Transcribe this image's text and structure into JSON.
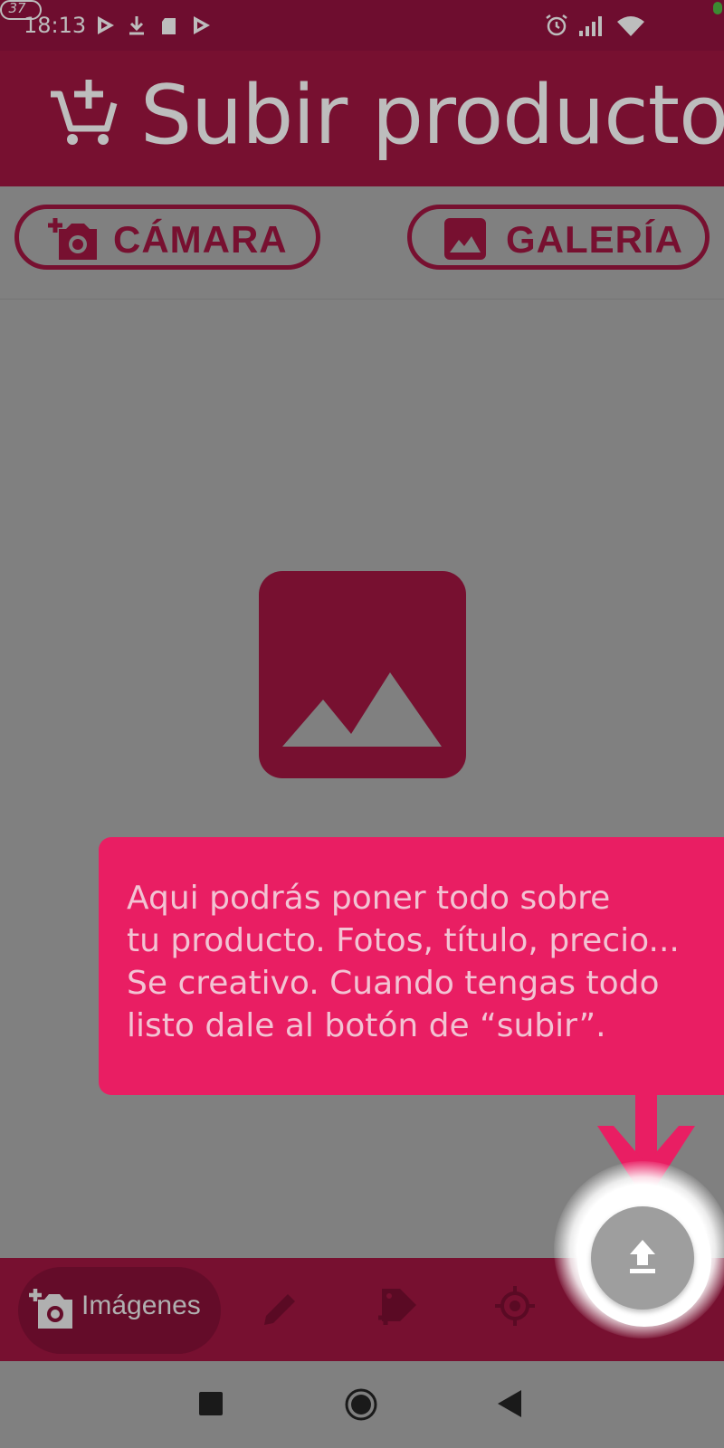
{
  "status_bar": {
    "time": "18:13",
    "battery_level": "37",
    "icons": [
      "play-store-icon",
      "download-icon",
      "sd-card-icon",
      "play-store-icon",
      "alarm-icon",
      "signal-icon",
      "wifi-icon",
      "battery-icon"
    ]
  },
  "app_bar": {
    "title": "Subir producto",
    "icon": "add-shopping-cart-icon"
  },
  "toolbar": {
    "camera_label": "CÁMARA",
    "gallery_label": "GALERÍA"
  },
  "placeholder": {
    "icon": "image-icon"
  },
  "tooltip": {
    "text": "Aqui podrás poner todo sobre\ntu producto. Fotos, título, precio...\nSe creativo. Cuando tengas todo\nlisto dale al botón de “subir”."
  },
  "bottom_nav": {
    "items": [
      {
        "label": "Imágenes",
        "icon": "add-photo-icon",
        "active": true
      },
      {
        "label": "",
        "icon": "pencil-icon",
        "active": false
      },
      {
        "label": "",
        "icon": "add-tag-icon",
        "active": false
      },
      {
        "label": "",
        "icon": "location-target-icon",
        "active": false
      }
    ]
  },
  "fab": {
    "icon": "upload-icon"
  },
  "system_nav": {
    "icons": [
      "recents-square-icon",
      "home-circle-icon",
      "back-triangle-icon"
    ]
  },
  "colors": {
    "primary_dark": "#771030",
    "status_bar": "#6e0d2f",
    "accent": "#e91e63",
    "scrim": "#808080"
  }
}
